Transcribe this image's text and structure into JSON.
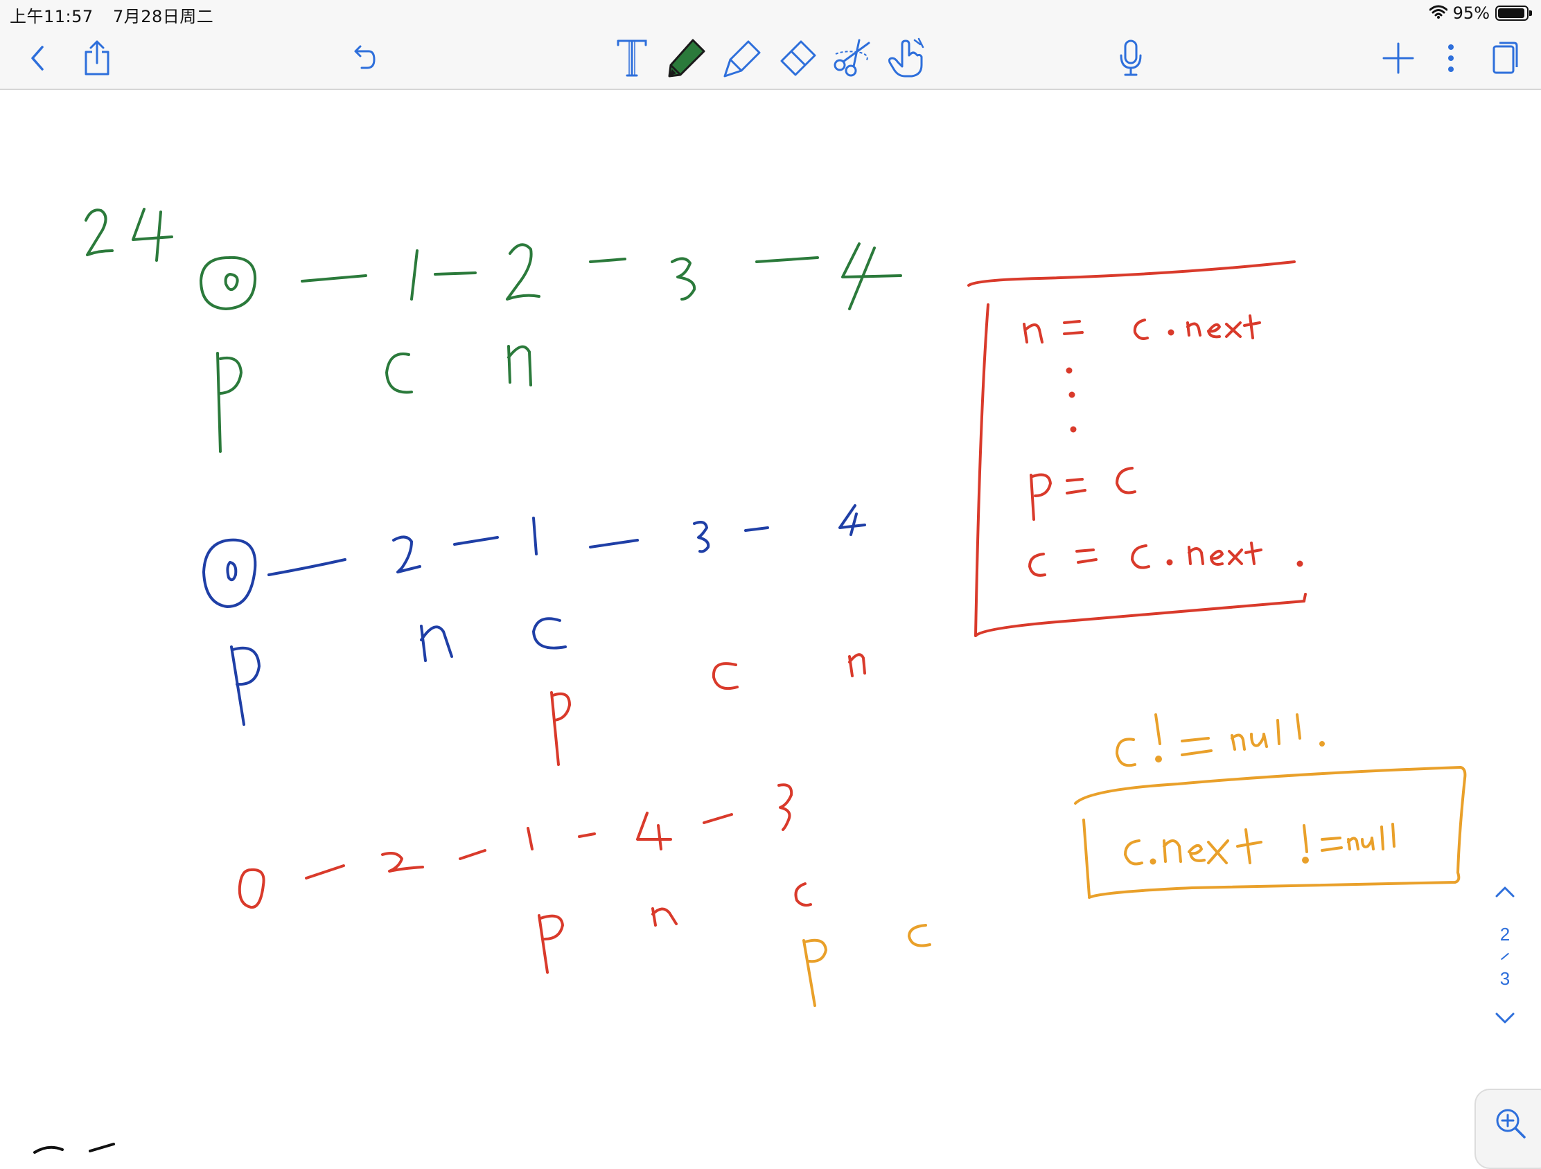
{
  "status_bar": {
    "time": "上午11:57",
    "date": "7月28日周二",
    "battery": "95%",
    "battery_level": 0.95
  },
  "toolbar": {
    "left": [
      {
        "icon": "chevron-left-icon"
      },
      {
        "icon": "share-icon"
      },
      {
        "icon": "undo-icon"
      }
    ],
    "tools": [
      {
        "icon": "text-tool-icon"
      },
      {
        "icon": "pen-tool-icon",
        "selected": true
      },
      {
        "icon": "highlighter-tool-icon"
      },
      {
        "icon": "eraser-tool-icon"
      },
      {
        "icon": "lasso-scissors-icon"
      },
      {
        "icon": "hand-pointer-icon"
      }
    ],
    "center": [
      {
        "icon": "microphone-icon"
      }
    ],
    "right": [
      {
        "icon": "plus-icon"
      },
      {
        "icon": "more-vertical-icon"
      },
      {
        "icon": "pages-icon"
      }
    ]
  },
  "colors": {
    "accent": "#2e6fdb",
    "ink_green": "#2b7a3b",
    "ink_blue": "#1f3fa6",
    "ink_red": "#d93a2b",
    "ink_orange": "#e9a02a"
  },
  "pager": {
    "current": "2",
    "total": "3"
  }
}
